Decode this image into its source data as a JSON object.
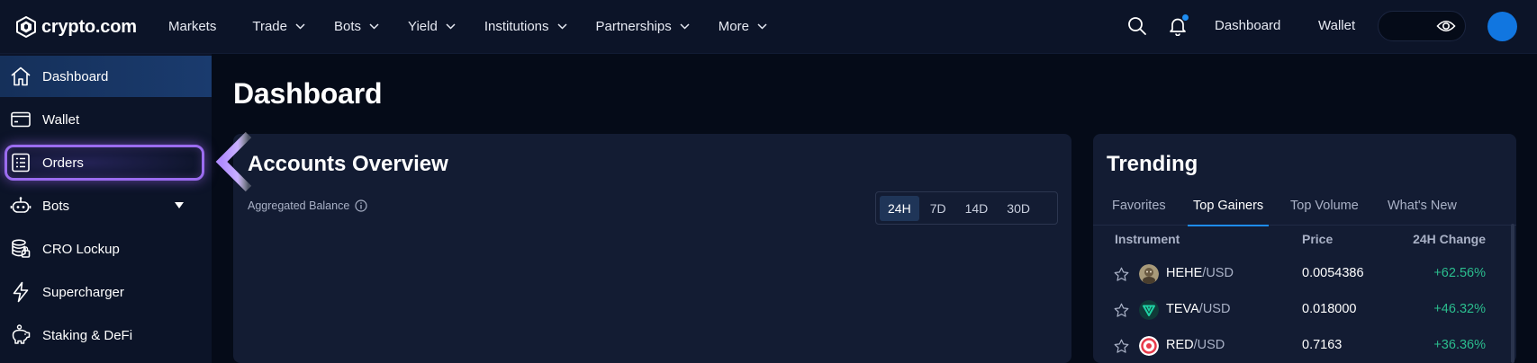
{
  "brand": {
    "name": "crypto.com"
  },
  "topnav": {
    "items": [
      {
        "label": "Markets",
        "dropdown": false
      },
      {
        "label": "Trade",
        "dropdown": true
      },
      {
        "label": "Bots",
        "dropdown": true
      },
      {
        "label": "Yield",
        "dropdown": true
      },
      {
        "label": "Institutions",
        "dropdown": true
      },
      {
        "label": "Partnerships",
        "dropdown": true
      },
      {
        "label": "More",
        "dropdown": true
      }
    ],
    "dashboard_link": "Dashboard",
    "wallet_link": "Wallet",
    "icons": [
      "search-icon",
      "bell-icon",
      "eye-icon"
    ],
    "accent": "#1e8cf0"
  },
  "sidebar": {
    "items": [
      {
        "label": "Dashboard",
        "icon": "home-icon",
        "active": true
      },
      {
        "label": "Wallet",
        "icon": "wallet-icon"
      },
      {
        "label": "Orders",
        "icon": "orders-list-icon",
        "highlighted": true
      },
      {
        "label": "Bots",
        "icon": "robot-icon",
        "has_caret": true
      },
      {
        "label": "CRO Lockup",
        "icon": "coin-stack-icon"
      },
      {
        "label": "Supercharger",
        "icon": "lightning-icon"
      },
      {
        "label": "Staking & DeFi",
        "icon": "piggy-bank-icon"
      }
    ]
  },
  "main": {
    "title": "Dashboard",
    "accounts": {
      "title": "Accounts Overview",
      "aggregated_label": "Aggregated Balance",
      "ranges": [
        "24H",
        "7D",
        "14D",
        "30D"
      ],
      "active_range": "24H"
    },
    "trending": {
      "title": "Trending",
      "tabs": [
        "Favorites",
        "Top Gainers",
        "Top Volume",
        "What's New"
      ],
      "active_tab": "Top Gainers",
      "columns": {
        "instrument": "Instrument",
        "price": "Price",
        "change": "24H Change"
      },
      "rows": [
        {
          "base": "HEHE",
          "quote": "/USD",
          "price": "0.0054386",
          "change": "+62.56%"
        },
        {
          "base": "TEVA",
          "quote": "/USD",
          "price": "0.018000",
          "change": "+46.32%"
        },
        {
          "base": "RED",
          "quote": "/USD",
          "price": "0.7163",
          "change": "+36.36%"
        }
      ],
      "positive_color": "#2bbd8e"
    }
  }
}
